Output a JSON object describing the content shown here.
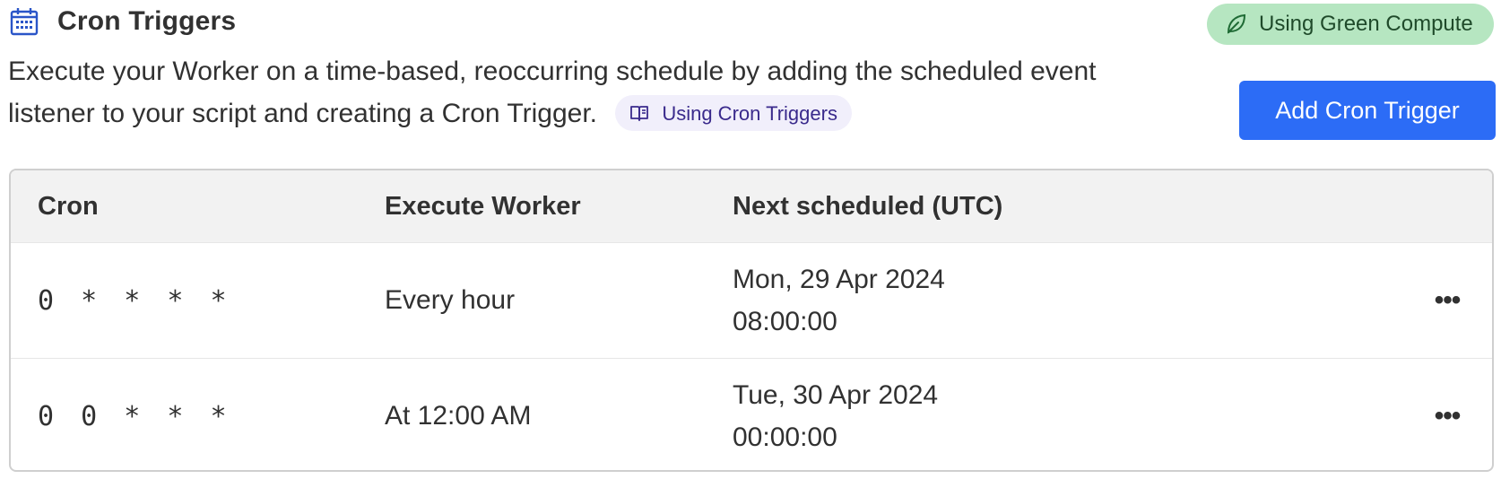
{
  "header": {
    "title": "Cron Triggers",
    "icon": "calendar-icon"
  },
  "badge": {
    "label": "Using Green Compute",
    "icon": "leaf-icon",
    "color": "#b6e6c1"
  },
  "description": {
    "text": "Execute your Worker on a time-based, reoccurring schedule by adding the scheduled event listener to your script and creating a Cron Trigger.",
    "doc_link": {
      "label": "Using Cron Triggers",
      "icon": "book-icon"
    }
  },
  "actions": {
    "add_button": "Add Cron Trigger",
    "accent_color": "#2c6cf6"
  },
  "table": {
    "columns": [
      "Cron",
      "Execute Worker",
      "Next scheduled (UTC)"
    ],
    "rows": [
      {
        "cron": "0 * * * *",
        "execute": "Every hour",
        "next_date": "Mon, 29 Apr 2024",
        "next_time": "08:00:00",
        "menu": "•••"
      },
      {
        "cron": "0 0 * * *",
        "execute": "At 12:00 AM",
        "next_date": "Tue, 30 Apr 2024",
        "next_time": "00:00:00",
        "menu": "•••"
      }
    ]
  }
}
